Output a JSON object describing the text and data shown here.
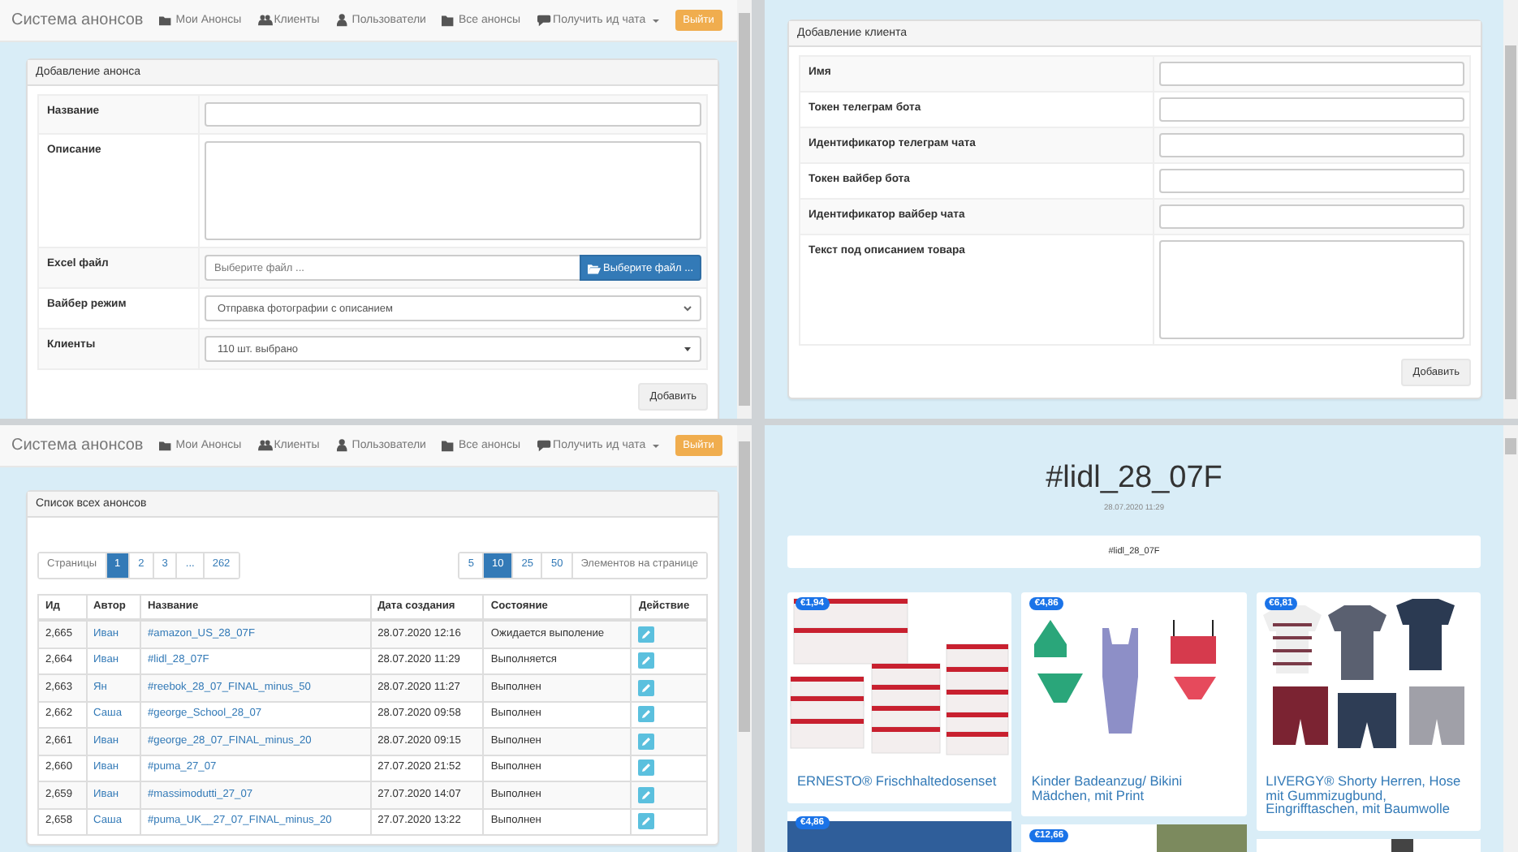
{
  "announcement_form": {
    "navbar": {
      "brand": "Система анонсов",
      "items": [
        {
          "label": "Мои Анонсы",
          "kind": "link"
        },
        {
          "label": "Клиенты",
          "kind": "link"
        },
        {
          "label": "Пользователи",
          "kind": "link"
        },
        {
          "label": "Все анонсы",
          "kind": "link"
        },
        {
          "label": "Получить ид чата",
          "kind": "dropdown"
        }
      ],
      "logout": "Выйти"
    },
    "panel_title": "Добавление анонса",
    "fields": [
      {
        "label": "Название",
        "kind": "text"
      },
      {
        "label": "Описание",
        "kind": "textarea"
      },
      {
        "label": "Excel файл",
        "kind": "file",
        "placeholder": "Выберите файл ...",
        "button": "Выберите файл ..."
      },
      {
        "label": "Вайбер режим",
        "kind": "select",
        "value": "Отправка фотографии с описанием"
      },
      {
        "label": "Клиенты",
        "kind": "multiselect",
        "value": "110 шт. выбрано"
      }
    ],
    "submit": "Добавить"
  },
  "client_form": {
    "panel_title": "Добавление клиента",
    "fields": [
      {
        "label": "Имя",
        "kind": "text"
      },
      {
        "label": "Токен телеграм бота",
        "kind": "text"
      },
      {
        "label": "Идентификатор телеграм чата",
        "kind": "text"
      },
      {
        "label": "Токен вайбер бота",
        "kind": "text"
      },
      {
        "label": "Идентификатор вайбер чата",
        "kind": "text"
      },
      {
        "label": "Текст под описанием товара",
        "kind": "textarea"
      }
    ],
    "submit": "Добавить"
  },
  "announcement_list": {
    "navbar": {
      "brand": "Система анонсов",
      "items": [
        {
          "label": "Мои Анонсы",
          "kind": "link"
        },
        {
          "label": "Клиенты",
          "kind": "link"
        },
        {
          "label": "Пользователи",
          "kind": "link"
        },
        {
          "label": "Все анонсы",
          "kind": "link"
        },
        {
          "label": "Получить ид чата",
          "kind": "dropdown"
        }
      ],
      "logout": "Выйти"
    },
    "panel_title": "Список всех анонсов",
    "pagination": {
      "label": "Страницы",
      "pages": [
        {
          "label": "1",
          "selected": true
        },
        {
          "label": "2",
          "selected": false
        },
        {
          "label": "3",
          "selected": false
        },
        {
          "label": "...",
          "selected": false
        },
        {
          "label": "262",
          "selected": false
        }
      ]
    },
    "page_size": {
      "options": [
        {
          "label": "5",
          "selected": false
        },
        {
          "label": "10",
          "selected": true
        },
        {
          "label": "25",
          "selected": false
        },
        {
          "label": "50",
          "selected": false
        }
      ],
      "label": "Элементов на странице"
    },
    "columns": [
      "Ид",
      "Автор",
      "Название",
      "Дата создания",
      "Состояние",
      "Действие"
    ],
    "rows": [
      {
        "id": "2,665",
        "author": "Иван",
        "name": "#amazon_US_28_07F",
        "created": "28.07.2020 12:16",
        "status": "Ожидается выполение"
      },
      {
        "id": "2,664",
        "author": "Иван",
        "name": "#lidl_28_07F",
        "created": "28.07.2020 11:29",
        "status": "Выполняется"
      },
      {
        "id": "2,663",
        "author": "Ян",
        "name": "#reebok_28_07_FINAL_minus_50",
        "created": "28.07.2020 11:27",
        "status": "Выполнен"
      },
      {
        "id": "2,662",
        "author": "Саша",
        "name": "#george_School_28_07",
        "created": "28.07.2020 09:58",
        "status": "Выполнен"
      },
      {
        "id": "2,661",
        "author": "Иван",
        "name": "#george_28_07_FINAL_minus_20",
        "created": "28.07.2020 09:15",
        "status": "Выполнен"
      },
      {
        "id": "2,660",
        "author": "Иван",
        "name": "#puma_27_07",
        "created": "27.07.2020 21:52",
        "status": "Выполнен"
      },
      {
        "id": "2,659",
        "author": "Иван",
        "name": "#massimodutti_27_07",
        "created": "27.07.2020 14:07",
        "status": "Выполнен"
      },
      {
        "id": "2,658",
        "author": "Саша",
        "name": "#puma_UK__27_07_FINAL_minus_20",
        "created": "27.07.2020 13:22",
        "status": "Выполнен"
      }
    ]
  },
  "announcement_view": {
    "title": "#lidl_28_07F",
    "date": "28.07.2020 11:29",
    "hashtag": "#lidl_28_07F",
    "products": [
      {
        "kind": "product",
        "price": "€1,94",
        "name": "ERNESTO® Frischhaltedosenset"
      },
      {
        "kind": "product",
        "price": "€4,86",
        "name": "Kinder Badeanzug/ Bikini Mädchen, mit Print"
      },
      {
        "kind": "product",
        "price": "€6,81",
        "name": "LIVERGY® Shorty Herren, Hose mit Gummizugbund, Eingrifftaschen, mit Baumwolle"
      },
      {
        "kind": "product",
        "price": "€4,86"
      },
      {
        "kind": "product",
        "price": "€12,66"
      },
      {
        "kind": "photo"
      }
    ]
  }
}
